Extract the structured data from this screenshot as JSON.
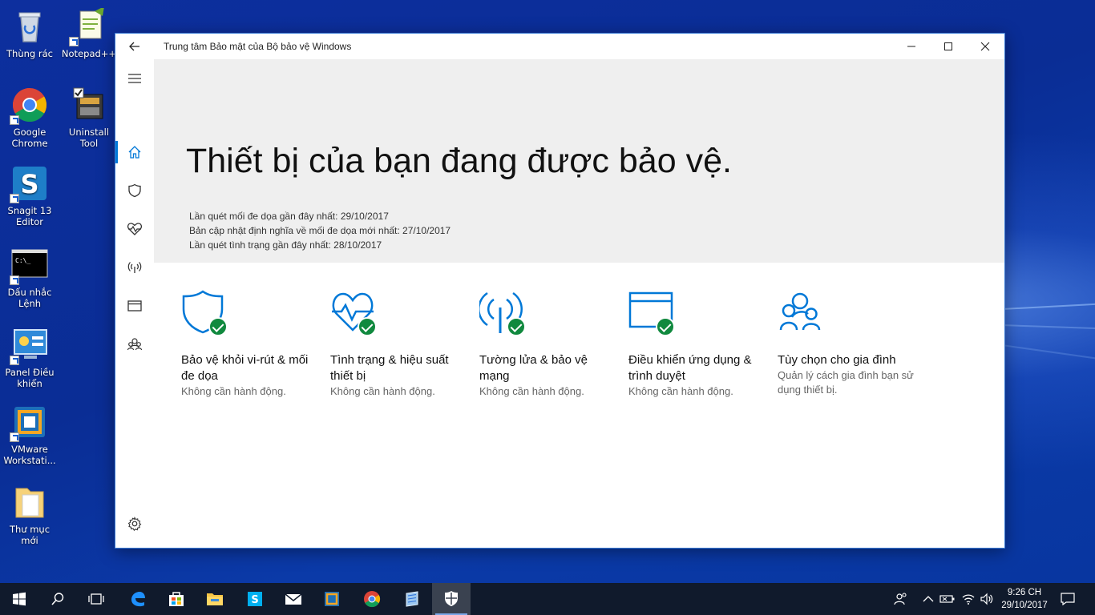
{
  "desktop": {
    "icons": [
      {
        "label": "Thùng rác",
        "icon": "recycle-bin-icon"
      },
      {
        "label": "Notepad++",
        "icon": "notepad-plus-plus-icon"
      },
      {
        "label": "Google Chrome",
        "icon": "chrome-icon"
      },
      {
        "label": "Uninstall Tool",
        "icon": "uninstall-tool-icon"
      },
      {
        "label": "Snagit 13 Editor",
        "icon": "snagit-icon"
      },
      {
        "label": "Dấu nhắc Lệnh",
        "icon": "command-prompt-icon"
      },
      {
        "label": "Panel Điều khiển",
        "icon": "control-panel-icon"
      },
      {
        "label": "VMware Workstati...",
        "icon": "vmware-icon"
      },
      {
        "label": "Thư mục mới",
        "icon": "folder-icon"
      }
    ]
  },
  "window": {
    "title": "Trung tâm Bảo mật của Bộ bảo vệ Windows",
    "accent": "#0078d7"
  },
  "hero": {
    "heading": "Thiết bị của bạn đang được bảo vệ.",
    "last_scan": "Lần quét mối đe dọa gần đây nhất:  29/10/2017",
    "last_update": "Bản cập nhật định nghĩa về mối đe dọa mới nhất:  27/10/2017",
    "last_health": "Lần quét tình trạng gần đây nhất:  28/10/2017"
  },
  "tiles": [
    {
      "title": "Bảo vệ khỏi vi-rút & mối đe dọa",
      "status": "Không cần hành động.",
      "icon": "shield-icon",
      "ok": true
    },
    {
      "title": "Tình trạng & hiệu suất thiết bị",
      "status": "Không cần hành động.",
      "icon": "heart-pulse-icon",
      "ok": true
    },
    {
      "title": "Tường lửa & bảo vệ mạng",
      "status": "Không cần hành động.",
      "icon": "wireless-antenna-icon",
      "ok": true
    },
    {
      "title": "Điều khiển ứng dụng & trình duyệt",
      "status": "Không cần hành động.",
      "icon": "app-browser-icon",
      "ok": true
    },
    {
      "title": "Tùy chọn cho gia đình",
      "status": "Quản lý cách gia đình bạn sử dụng thiết bị.",
      "icon": "family-icon",
      "ok": false
    }
  ],
  "taskbar": {
    "time": "9:26 CH",
    "date": "29/10/2017"
  }
}
